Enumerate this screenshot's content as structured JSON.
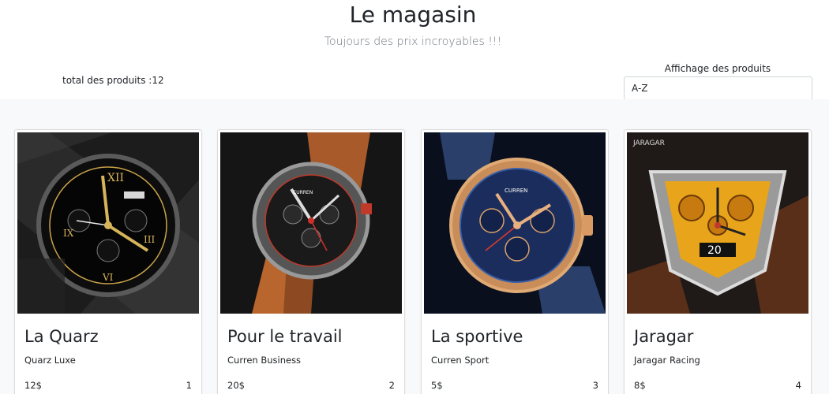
{
  "header": {
    "title": "Le magasin",
    "subtitle": "Toujours des prix incroyables !!!"
  },
  "toolbar": {
    "total_label": "total des produits :12",
    "sort_label": "Affichage des produits",
    "sort_value": "A-Z"
  },
  "products": [
    {
      "name": "La Quarz",
      "subtitle": "Quarz Luxe",
      "price": "12$",
      "id": "1",
      "image": "black-gold-watch-image"
    },
    {
      "name": "Pour le travail",
      "subtitle": "Curren Business",
      "price": "20$",
      "id": "2",
      "image": "leather-strap-watch-image"
    },
    {
      "name": "La sportive",
      "subtitle": "Curren Sport",
      "price": "5$",
      "id": "3",
      "image": "blue-steel-watch-image"
    },
    {
      "name": "Jaragar",
      "subtitle": "Jaragar Racing",
      "price": "8$",
      "id": "4",
      "image": "yellow-skeleton-watch-image"
    }
  ],
  "image_text": {
    "brand_curren": "CURREN",
    "brand_jaragar": "JARAGAR",
    "dial_number": "20"
  }
}
